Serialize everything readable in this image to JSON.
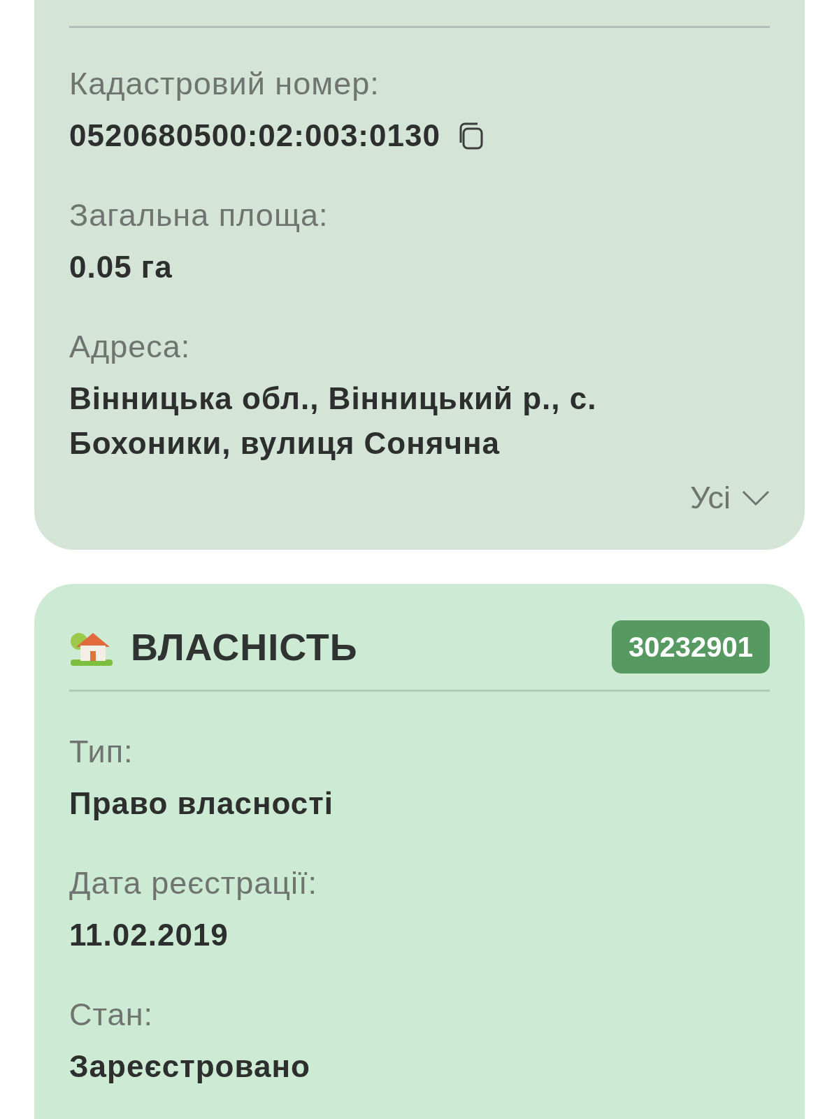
{
  "land_card": {
    "fields": [
      {
        "label": "Кадастровий номер:",
        "value": "0520680500:02:003:0130",
        "copyable": true
      },
      {
        "label": "Загальна площа:",
        "value": "0.05 га",
        "copyable": false
      },
      {
        "label": "Адреса:",
        "value": "Вінницька обл., Вінницький р., с. Бохоники, вулиця Сонячна",
        "copyable": false
      }
    ],
    "expand_link": "Усі"
  },
  "ownership_card": {
    "title": "ВЛАСНІСТЬ",
    "badge": "30232901",
    "fields": [
      {
        "label": "Тип:",
        "value": "Право власності"
      },
      {
        "label": "Дата реєстрації:",
        "value": "11.02.2019"
      },
      {
        "label": "Стан:",
        "value": "Зареєстровано"
      }
    ]
  }
}
